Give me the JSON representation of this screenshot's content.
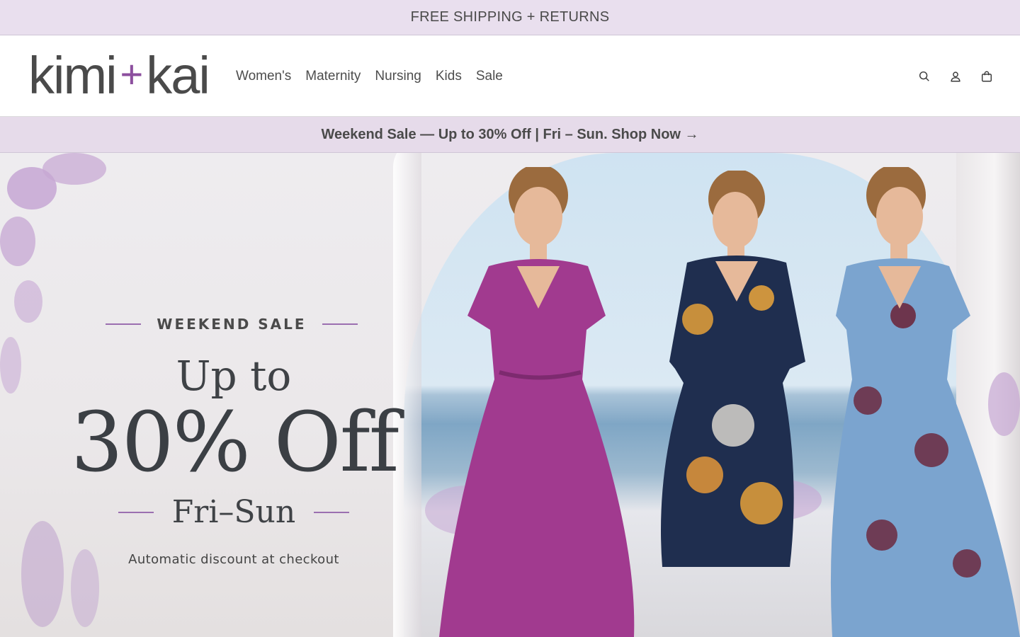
{
  "announcement": {
    "text": "FREE SHIPPING + RETURNS"
  },
  "header": {
    "logo": {
      "left": "kimi",
      "plus": "+",
      "right": "kai"
    },
    "nav": [
      {
        "label": "Women's"
      },
      {
        "label": "Maternity"
      },
      {
        "label": "Nursing"
      },
      {
        "label": "Kids"
      },
      {
        "label": "Sale"
      }
    ],
    "icons": [
      "search-icon",
      "account-icon",
      "cart-icon"
    ]
  },
  "promo_bar": {
    "text": "Weekend Sale — Up to 30% Off | Fri – Sun. Shop Now →"
  },
  "hero": {
    "eyebrow": "WEEKEND SALE",
    "headline_top": "Up to",
    "headline_main": "30% Off",
    "days": "Fri–Sun",
    "subtext": "Automatic discount at checkout"
  },
  "colors": {
    "announcement_bg": "#e9dfee",
    "promo_bg": "#e6dbea",
    "accent": "#8c4f9e",
    "text": "#3f3f3f"
  }
}
